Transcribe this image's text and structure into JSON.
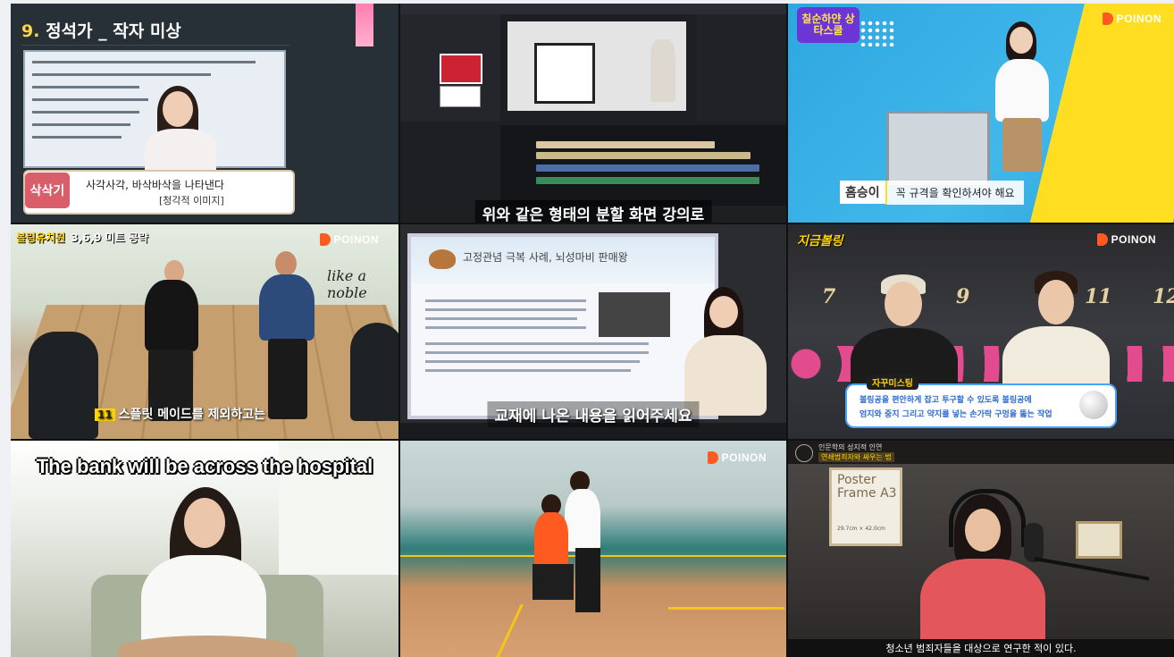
{
  "tiles": {
    "t1": {
      "title_num": "9.",
      "title": "정석가 _ 작자 미상",
      "tag": "삭삭기",
      "caption_line1": "사각사각, 바삭바삭을 나타낸다",
      "caption_line2": "[청각적 이미지]"
    },
    "t2": {
      "subtitle": "위와 같은 형태의 분할 화면 강의로"
    },
    "t3": {
      "logo": "칠순하얀 상타스쿨",
      "brand": "POINON",
      "speaker": "흠승이",
      "caption": "꼭 규격을 확인하셔야 해요"
    },
    "t4": {
      "badge": "볼링유치원",
      "badge_sub": "3,6,9 미트 공략",
      "brand": "POINON",
      "wall_text": "like a noble",
      "caption_icon": "11",
      "caption": "스플릿 메이드를 제외하고는"
    },
    "t5": {
      "board_title": "고정관념 극복 사례, 뇌성마비 판매왕",
      "subtitle": "교재에 나온 내용을 읽어주세요"
    },
    "t6": {
      "logo": "지금볼링",
      "brand": "POINON",
      "lane_numbers": [
        "7",
        "9",
        "11",
        "12"
      ],
      "info_label": "자꾸미스팅",
      "info_line1": "볼링공을 편안하게 잡고 투구할 수 있도록 볼링공에",
      "info_line2": "엄지와 중지 그리고 약지를 넣는 손가락 구멍을 뚫는 작업"
    },
    "t7": {
      "headline": "The bank will be across the hospital"
    },
    "t8": {
      "brand": "POINON"
    },
    "t9": {
      "header_line1": "인문학의 성지적 인연",
      "header_line2": "연쇄범죄자와 싸우는 법",
      "poster_title": "Poster Frame A3",
      "poster_sub": "29.7cm × 42.0cm",
      "subtitle": "청소년 범죄자들을 대상으로 연구한 적이 있다."
    }
  },
  "colors": {
    "poinon_orange": "#ff5a1f",
    "accent_yellow": "#ffd400"
  }
}
